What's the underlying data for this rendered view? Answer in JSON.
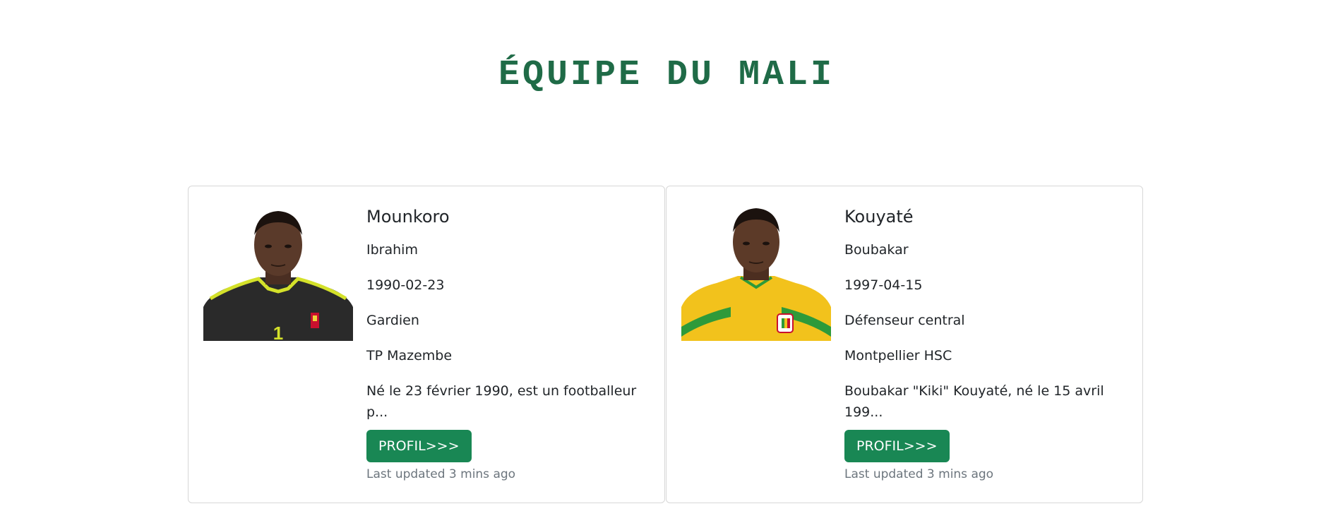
{
  "page": {
    "title": "ÉQUIPE DU MALI"
  },
  "players": [
    {
      "last_name": "Mounkoro",
      "first_name": "Ibrahim",
      "birth_date": "1990-02-23",
      "position": "Gardien",
      "club": "TP Mazembe",
      "description": "Né le 23 février 1990, est un footballeur p...",
      "profile_button": "PROFIL>>>",
      "last_updated": "Last updated 3 mins ago",
      "jersey_color": "#2a2a2a",
      "trim_color": "#d4e12a"
    },
    {
      "last_name": "Kouyaté",
      "first_name": "Boubakar",
      "birth_date": "1997-04-15",
      "position": "Défenseur central",
      "club": "Montpellier HSC",
      "description": "Boubakar \"Kiki\" Kouyaté, né le 15 avril 199...",
      "profile_button": "PROFIL>>>",
      "last_updated": "Last updated 3 mins ago",
      "jersey_color": "#f2c21c",
      "trim_color": "#2e9a3a"
    }
  ]
}
